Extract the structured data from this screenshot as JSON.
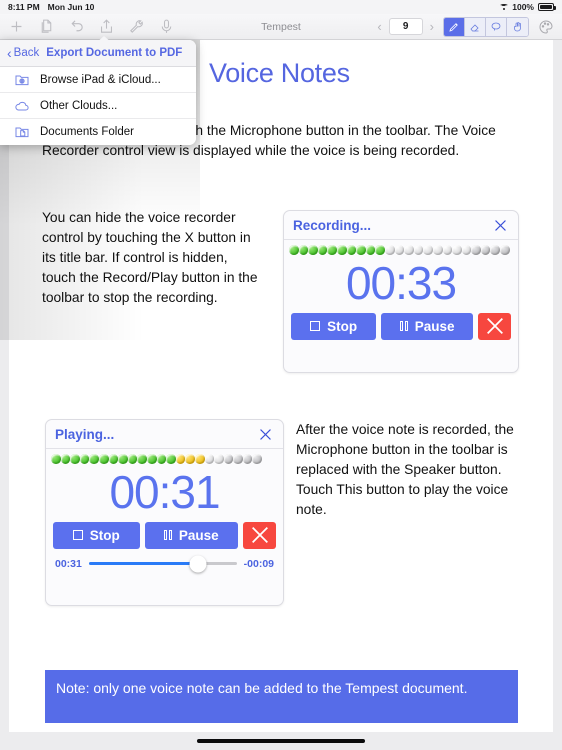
{
  "status_bar": {
    "time": "8:11 PM",
    "date": "Mon Jun 10",
    "battery_percent": "100%",
    "wifi_icon": "wifi-icon",
    "battery_icon": "battery-icon"
  },
  "toolbar": {
    "icons": [
      {
        "name": "add-icon",
        "label": "+"
      },
      {
        "name": "duplicate-icon",
        "label": ""
      },
      {
        "name": "undo-icon",
        "label": ""
      },
      {
        "name": "share-export-icon",
        "label": ""
      },
      {
        "name": "wrench-settings-icon",
        "label": ""
      },
      {
        "name": "microphone-icon",
        "label": ""
      }
    ],
    "document_title": "Tempest",
    "page_number": "9",
    "prev_page_icon": "chevron-left-icon",
    "next_page_icon": "chevron-right-icon",
    "pen_tools": [
      {
        "name": "pen-tool",
        "selected": true
      },
      {
        "name": "eraser-tool",
        "selected": false
      },
      {
        "name": "lasso-tool",
        "selected": false
      },
      {
        "name": "hand-tool",
        "selected": false
      }
    ],
    "palette_icon": "color-palette-icon"
  },
  "popover": {
    "back_label": "Back",
    "back_icon": "chevron-left-icon",
    "title": "Export Document to PDF",
    "items": [
      {
        "label": "Browse iPad & iCloud...",
        "icon": "folder-globe-icon"
      },
      {
        "label": "Other Clouds...",
        "icon": "cloud-icon"
      },
      {
        "label": "Documents Folder",
        "icon": "folder-document-icon"
      }
    ]
  },
  "document": {
    "title": "Voice Notes",
    "paragraph_1": "To add a voice note, touch the Microphone button in the toolbar. The Voice Recorder control view is displayed while the voice is being recorded.",
    "paragraph_2": "You can hide the voice recorder control by touching the X button in its title bar. If control is hidden, touch the Record/Play button in the toolbar to stop the recording.",
    "paragraph_3": "After the voice note is recorded, the Microphone button in the toolbar is replaced with the Speaker button. Touch This button to play the voice note.",
    "note": "Note: only one voice note can be added to the Tempest document.",
    "note_background": "#566ce8",
    "title_color": "#5566e0"
  },
  "recorder_widget": {
    "title": "Recording...",
    "close_icon": "close-x-icon",
    "timer": "00:33",
    "meter": {
      "green": 10,
      "yellow": 0,
      "gray": 13
    },
    "buttons": [
      {
        "label": "Stop",
        "icon": "stop-square-icon",
        "color": "#5b70ee"
      },
      {
        "label": "Pause",
        "icon": "pause-bars-icon",
        "color": "#5b70ee"
      },
      {
        "label": "",
        "icon": "cancel-x-icon",
        "color": "#f7473f"
      }
    ]
  },
  "player_widget": {
    "title": "Playing...",
    "close_icon": "close-x-icon",
    "timer": "00:31",
    "meter": {
      "green": 13,
      "yellow": 3,
      "gray": 6
    },
    "buttons": [
      {
        "label": "Stop",
        "icon": "stop-square-icon",
        "color": "#5b70ee"
      },
      {
        "label": "Pause",
        "icon": "pause-bars-icon",
        "color": "#5b70ee"
      },
      {
        "label": "",
        "icon": "cancel-x-icon",
        "color": "#f7473f"
      }
    ],
    "elapsed": "00:31",
    "remaining": "-00:09",
    "progress_percent": 74
  }
}
